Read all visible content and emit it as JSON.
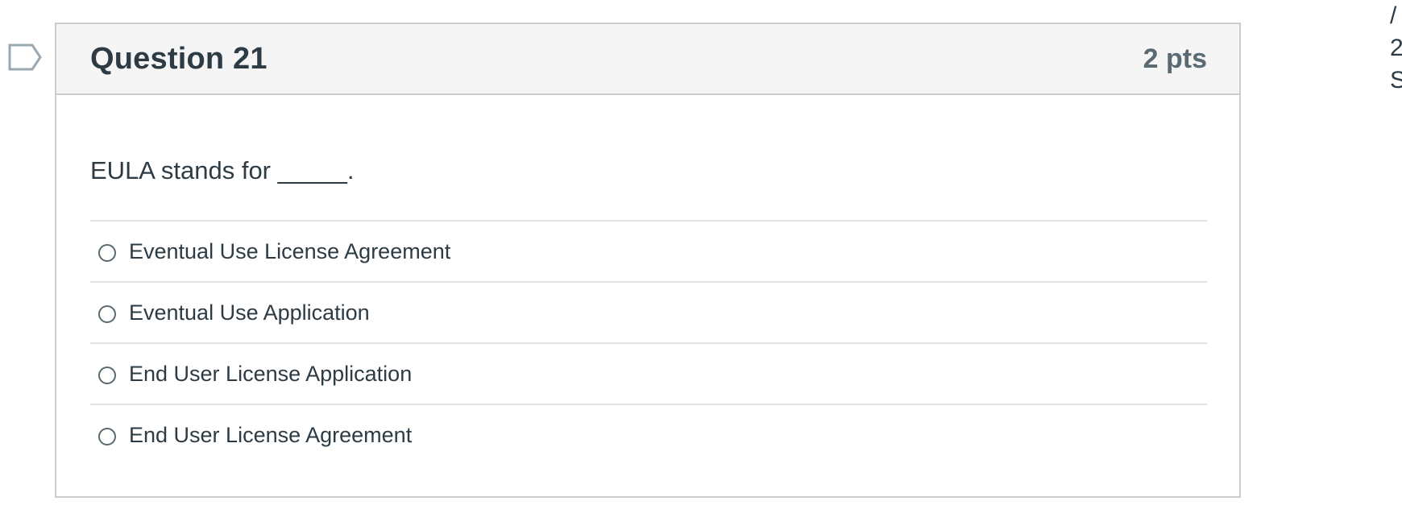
{
  "question": {
    "title": "Question 21",
    "points": "2 pts",
    "text": "EULA stands for _____.",
    "answers": [
      {
        "label": "Eventual Use License Agreement",
        "selected": false
      },
      {
        "label": "Eventual Use Application",
        "selected": false
      },
      {
        "label": "End User License Application",
        "selected": false
      },
      {
        "label": "End User License Agreement",
        "selected": false
      }
    ]
  },
  "flag": {
    "icon": "bookmark-flag-icon",
    "color": "#9aa8b2"
  },
  "side_panel": {
    "lines": [
      "/",
      "2",
      "S"
    ]
  },
  "colors": {
    "header_bg": "#f5f5f5",
    "border": "#c7cdd1",
    "text": "#2d3b45",
    "muted": "#5a6a73"
  }
}
